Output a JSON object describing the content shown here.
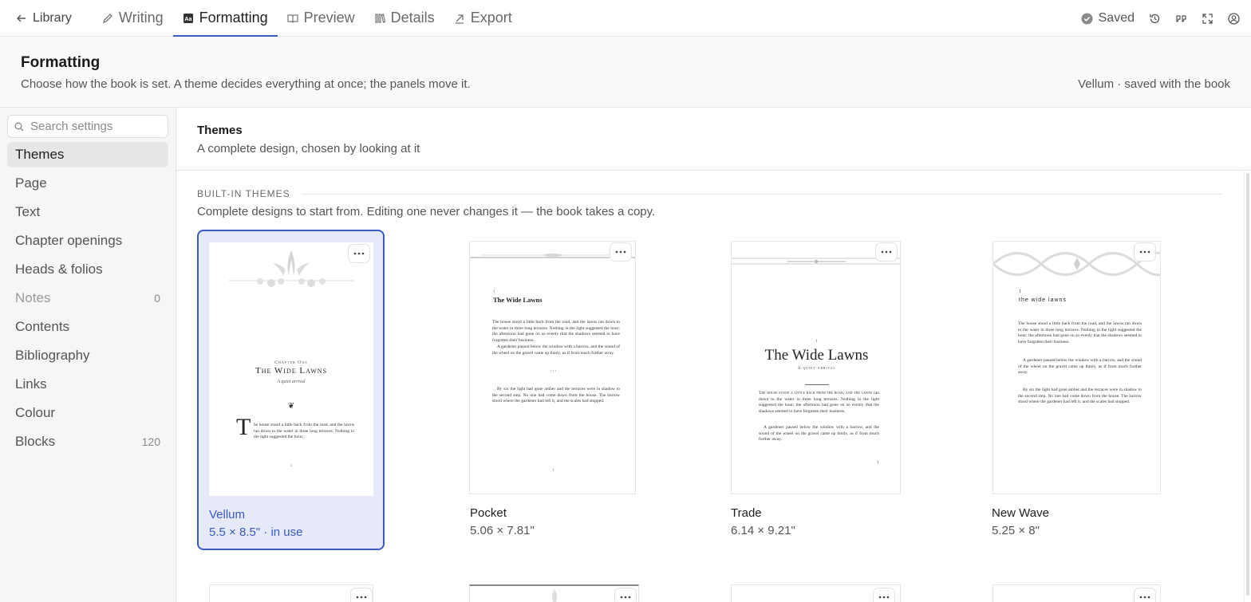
{
  "topbar": {
    "back_label": "Library",
    "tabs": [
      {
        "label": "Writing",
        "icon": "pencil-icon"
      },
      {
        "label": "Formatting",
        "icon": "type-icon",
        "active": true
      },
      {
        "label": "Preview",
        "icon": "book-icon"
      },
      {
        "label": "Details",
        "icon": "library-icon"
      },
      {
        "label": "Export",
        "icon": "export-arrow-icon"
      }
    ],
    "status": "Saved",
    "right_icons": [
      "history-icon",
      "quote-icon",
      "fullscreen-icon",
      "account-icon"
    ],
    "accent": "#3a5bbf"
  },
  "header": {
    "title": "Formatting",
    "subtitle": "Choose how the book is set. A theme decides everything at once; the panels move it.",
    "meta": "Vellum · saved with the book"
  },
  "sidebar": {
    "search_placeholder": "Search settings",
    "items": [
      {
        "label": "Themes",
        "count": ""
      },
      {
        "label": "Page",
        "count": ""
      },
      {
        "label": "Text",
        "count": ""
      },
      {
        "label": "Chapter openings",
        "count": ""
      },
      {
        "label": "Heads & folios",
        "count": ""
      },
      {
        "label": "Notes",
        "count": "0"
      },
      {
        "label": "Contents",
        "count": ""
      },
      {
        "label": "Bibliography",
        "count": ""
      },
      {
        "label": "Links",
        "count": ""
      },
      {
        "label": "Colour",
        "count": ""
      },
      {
        "label": "Blocks",
        "count": "120"
      }
    ]
  },
  "section": {
    "title": "Themes",
    "description": "A complete design, chosen by looking at it"
  },
  "group": {
    "label": "BUILT-IN THEMES",
    "description": "Complete designs to start from. Editing one never changes it — the book takes a copy."
  },
  "themes": [
    {
      "name": "Vellum",
      "size": "5.5 × 8.5\" · in use",
      "selected": true
    },
    {
      "name": "Pocket",
      "size": "5.06 × 7.81\""
    },
    {
      "name": "Trade",
      "size": "6.14 × 9.21\""
    },
    {
      "name": "New Wave",
      "size": "5.25 × 8\""
    }
  ],
  "sample": {
    "chapter_label": "Chapter One",
    "title": "The Wide Lawns",
    "title_lower": "the wide lawns",
    "subtitle": "A quiet arrival",
    "dropcap": "T",
    "vellum_text": "he house stood a little back from the road, and the lawns ran down to the water in three long terraces. Nothing in the light suggested the hour;",
    "para1": "The house stood a little back from the road, and the lawns ran down to the water in three long terraces. Nothing in the light suggested the hour; the afternoon had gone on so evenly that the shadows seemed to have forgotten their business.",
    "para2": "A gardener passed below the window with a barrow, and the sound of the wheel on the gravel came up thinly, as if from much further away.",
    "para3": "By six the light had gone amber and the terraces were in shadow to the second step. No one had come down from the house. The barrow stood where the gardener had left it, and the scales had stopped.",
    "trade_smallcaps": "The house stood a little back from the road, and the lawns",
    "trade_rest": "ran down to the water in three long terraces. Nothing in the light suggested the hour; the afternoon had gone on so evenly that the shadows seemed to have forgotten their business.",
    "asterism": "···",
    "fleuron": "❦",
    "folio": "1"
  }
}
